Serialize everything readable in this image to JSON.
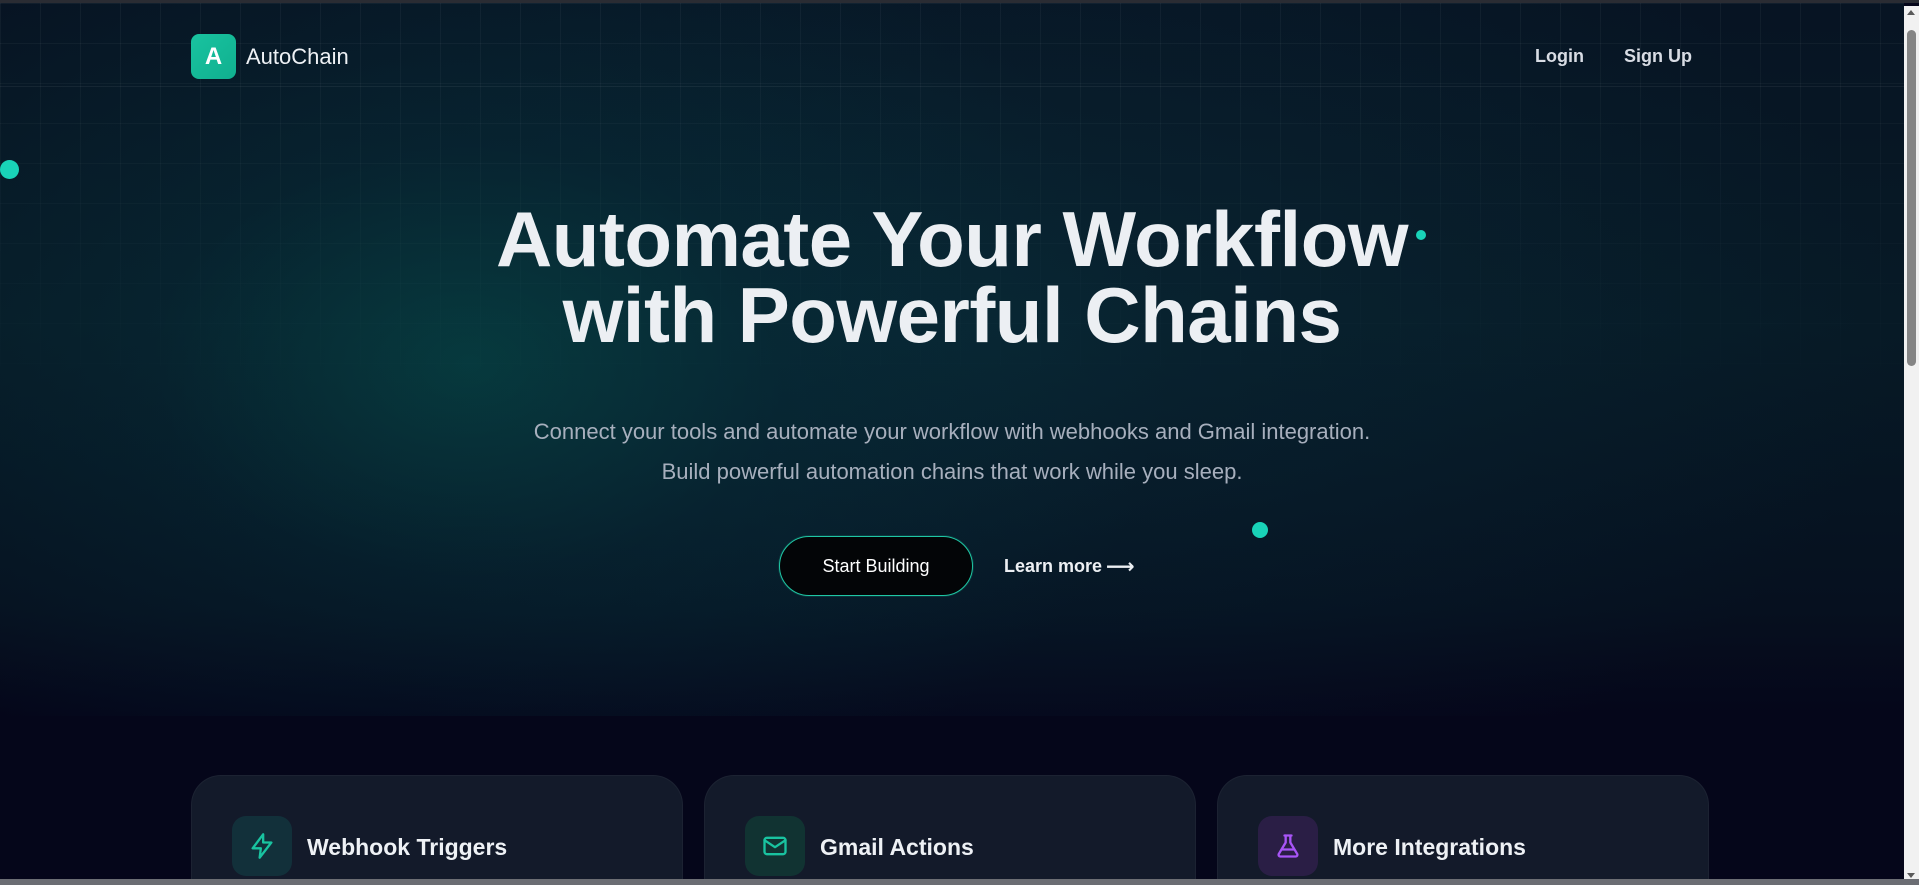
{
  "brand": {
    "logo_letter": "A",
    "name": "AutoChain"
  },
  "nav": {
    "login": "Login",
    "signup": "Sign Up"
  },
  "hero": {
    "title_line1": "Automate Your Workflow",
    "title_line2": "with Powerful Chains",
    "subtitle_line1": "Connect your tools and automate your workflow with webhooks and Gmail integration.",
    "subtitle_line2": "Build powerful automation chains that work while you sleep.",
    "primary_cta": "Start Building",
    "secondary_cta": "Learn more",
    "secondary_cta_arrow": "⟶"
  },
  "features": [
    {
      "title": "Webhook Triggers",
      "icon": "lightning-icon",
      "color": "#19c3a0"
    },
    {
      "title": "Gmail Actions",
      "icon": "mail-icon",
      "color": "#19c3a0"
    },
    {
      "title": "More Integrations",
      "icon": "flask-icon",
      "color": "#a855f7"
    }
  ],
  "colors": {
    "accent": "#19c3a0",
    "background": "#05061a",
    "purple": "#a855f7"
  }
}
